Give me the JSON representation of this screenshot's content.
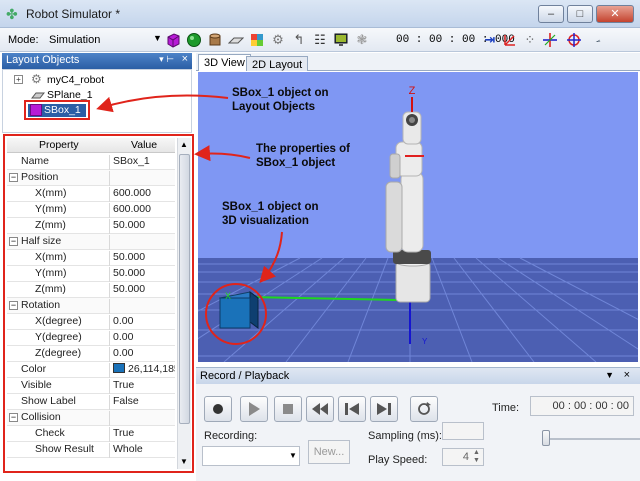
{
  "window": {
    "title": "Robot Simulator *",
    "minimize": "–",
    "maximize": "□",
    "close": "✕"
  },
  "toolbar": {
    "mode_label": "Mode:",
    "mode_value": "Simulation",
    "timecode": "00 : 00 : 00 : 000"
  },
  "layout_panel": {
    "title": "Layout Objects",
    "items": [
      {
        "label": "myC4_robot"
      },
      {
        "label": "SPlane_1"
      },
      {
        "label": "SBox_1"
      }
    ]
  },
  "property_grid": {
    "col_property": "Property",
    "col_value": "Value",
    "rows": [
      {
        "name": "Name",
        "value": "SBox_1"
      },
      {
        "name": "Position",
        "value": ""
      },
      {
        "name": "X(mm)",
        "value": "600.000"
      },
      {
        "name": "Y(mm)",
        "value": "600.000"
      },
      {
        "name": "Z(mm)",
        "value": "50.000"
      },
      {
        "name": "Half size",
        "value": ""
      },
      {
        "name": "X(mm)",
        "value": "50.000"
      },
      {
        "name": "Y(mm)",
        "value": "50.000"
      },
      {
        "name": "Z(mm)",
        "value": "50.000"
      },
      {
        "name": "Rotation",
        "value": ""
      },
      {
        "name": "X(degree)",
        "value": "0.00"
      },
      {
        "name": "Y(degree)",
        "value": "0.00"
      },
      {
        "name": "Z(degree)",
        "value": "0.00"
      },
      {
        "name": "Color",
        "value": "26,114,185"
      },
      {
        "name": "Visible",
        "value": "True"
      },
      {
        "name": "Show Label",
        "value": "False"
      },
      {
        "name": "Collision",
        "value": ""
      },
      {
        "name": "Check",
        "value": "True"
      },
      {
        "name": "Show Result",
        "value": "Whole"
      }
    ]
  },
  "tabs": [
    {
      "label": "3D View"
    },
    {
      "label": "2D Layout"
    }
  ],
  "view3d": {
    "axis_z": "Z",
    "axis_x": "X",
    "axis_y": "Y"
  },
  "annotations": {
    "layout": "SBox_1 object on\nLayout Objects",
    "properties": "The properties of\nSBox_1 object",
    "visual": "SBox_1 object on\n3D visualization"
  },
  "record": {
    "title": "Record / Playback",
    "time_label": "Time:",
    "time_value": "00 : 00 : 00 : 00",
    "recording_label": "Recording:",
    "new_button": "New...",
    "sampling_label": "Sampling (ms):",
    "play_speed_label": "Play Speed:",
    "play_speed_value": "4"
  },
  "colors": {
    "accent": "#2b5ea5",
    "annotation_red": "#e0241b",
    "sky": "#7f97f3",
    "floor": "#4c5fb2",
    "box": "#1a72b9"
  }
}
